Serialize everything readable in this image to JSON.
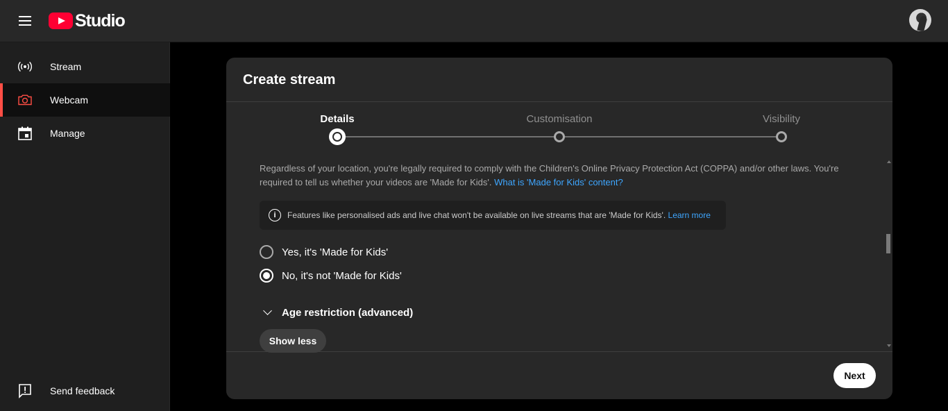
{
  "header": {
    "logo_text": "Studio",
    "menu_icon": "hamburger-menu-icon",
    "avatar_icon": "user-avatar"
  },
  "sidebar": {
    "items": [
      {
        "label": "Stream",
        "icon": "broadcast-icon"
      },
      {
        "label": "Webcam",
        "icon": "camera-icon",
        "active": true
      },
      {
        "label": "Manage",
        "icon": "calendar-icon"
      }
    ],
    "feedback": {
      "label": "Send feedback",
      "icon": "feedback-icon"
    }
  },
  "dialog": {
    "title": "Create stream",
    "steps": [
      {
        "label": "Details",
        "active": true
      },
      {
        "label": "Customisation",
        "active": false
      },
      {
        "label": "Visibility",
        "active": false
      }
    ],
    "coppa_text": "Regardless of your location, you're legally required to comply with the Children's Online Privacy Protection Act (COPPA) and/or other laws. You're required to tell us whether your videos are 'Made for Kids'.",
    "coppa_link": "What is 'Made for Kids' content?",
    "info_text": "Features like personalised ads and live chat won't be available on live streams that are 'Made for Kids'.",
    "info_link": "Learn more",
    "radio_yes": "Yes, it's 'Made for Kids'",
    "radio_no": "No, it's not 'Made for Kids'",
    "selected": "no",
    "age_restriction": "Age restriction (advanced)",
    "show_less": "Show less",
    "next": "Next"
  }
}
